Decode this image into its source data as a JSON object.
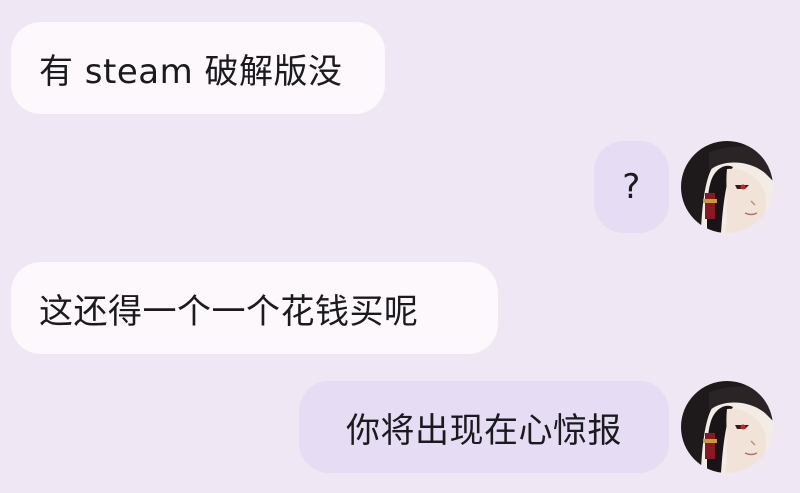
{
  "chat": {
    "messages": [
      {
        "direction": "incoming",
        "text": "有 steam 破解版没"
      },
      {
        "direction": "outgoing",
        "text": "?"
      },
      {
        "direction": "incoming",
        "text": "这还得一个一个花钱买呢"
      },
      {
        "direction": "outgoing",
        "text": "你将出现在心惊报"
      }
    ]
  },
  "colors": {
    "background": "#efe8f4",
    "incoming_bubble": "#fcf8fc",
    "outgoing_bubble": "#e6dcf4",
    "text": "#1b1b1f"
  },
  "avatars": [
    {
      "icon": "anime-character-avatar-icon"
    },
    {
      "icon": "anime-character-avatar-icon"
    }
  ]
}
